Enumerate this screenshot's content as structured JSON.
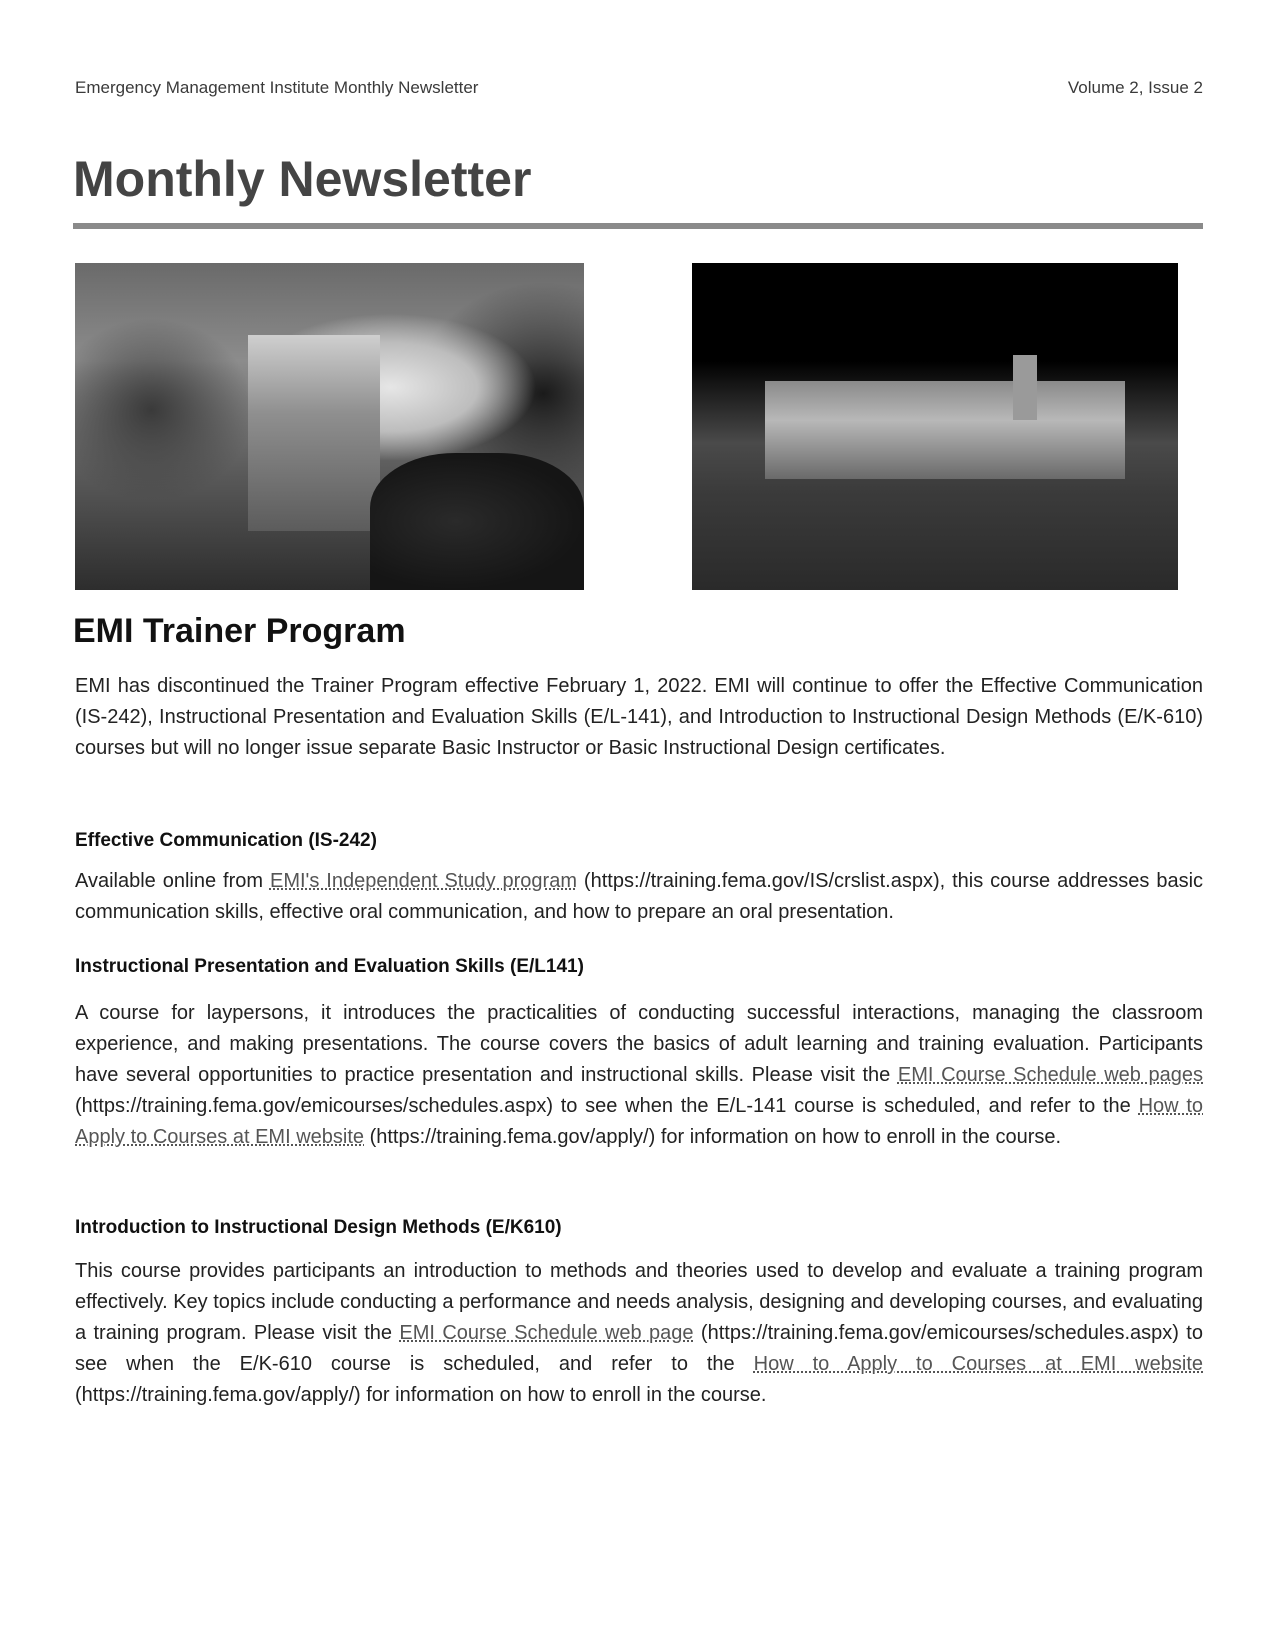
{
  "header": {
    "publication": "Emergency Management Institute Monthly Newsletter",
    "issue": "Volume 2, Issue 2"
  },
  "title": "Monthly Newsletter",
  "images": [
    {
      "alt": "Historic EMI campus building with dome and trees"
    },
    {
      "alt": "EMI campus buildings at night"
    }
  ],
  "article": {
    "heading": "EMI Trainer Program",
    "intro": "EMI has discontinued the Trainer Program effective February 1, 2022.  EMI will continue to offer the Effective Communication (IS-242), Instructional Presentation and Evaluation Skills (E/L-141), and Introduction to Instructional Design Methods (E/K-610) courses but will no longer issue separate Basic Instructor or Basic Instructional Design certificates.",
    "sections": [
      {
        "heading": "Effective Communication (IS-242)",
        "text_before": "Available online from ",
        "link1": "EMI's Independent Study program",
        "text_after1": " (https://training.fema.gov/IS/crslist.aspx), this course addresses basic communication skills, effective oral communication, and how to prepare an oral presentation."
      },
      {
        "heading": "Instructional Presentation and Evaluation Skills (E/L141)",
        "text_before": "A course for laypersons, it introduces the practicalities of conducting successful interactions, managing the classroom experience, and making presentations. The course covers the basics of adult learning and training evaluation. Participants have several opportunities to practice presentation and instructional skills. Please visit the ",
        "link1": "EMI Course Schedule web pages",
        "text_after1": " (https://training.fema.gov/emicourses/schedules.aspx) to see when the E/L-141 course is scheduled, and refer to the ",
        "link2": "How to Apply to Courses at EMI website",
        "text_after2": " (https://training.fema.gov/apply/) for information on how to enroll in the course."
      },
      {
        "heading": "Introduction to Instructional Design Methods (E/K610)",
        "text_before": "This course provides participants an introduction to methods and theories used to develop and evaluate a training program effectively. Key topics include conducting a performance and needs analysis, designing and developing courses, and evaluating a training program.   Please visit the ",
        "link1": "EMI Course Schedule web page",
        "text_after1": " (https://training.fema.gov/emicourses/schedules.aspx) to see when the E/K-610 course is scheduled, and refer to the ",
        "link2": "How to Apply to Courses at EMI website",
        "text_after2": " (https://training.fema.gov/apply/) for information on how to enroll in the course."
      }
    ]
  }
}
